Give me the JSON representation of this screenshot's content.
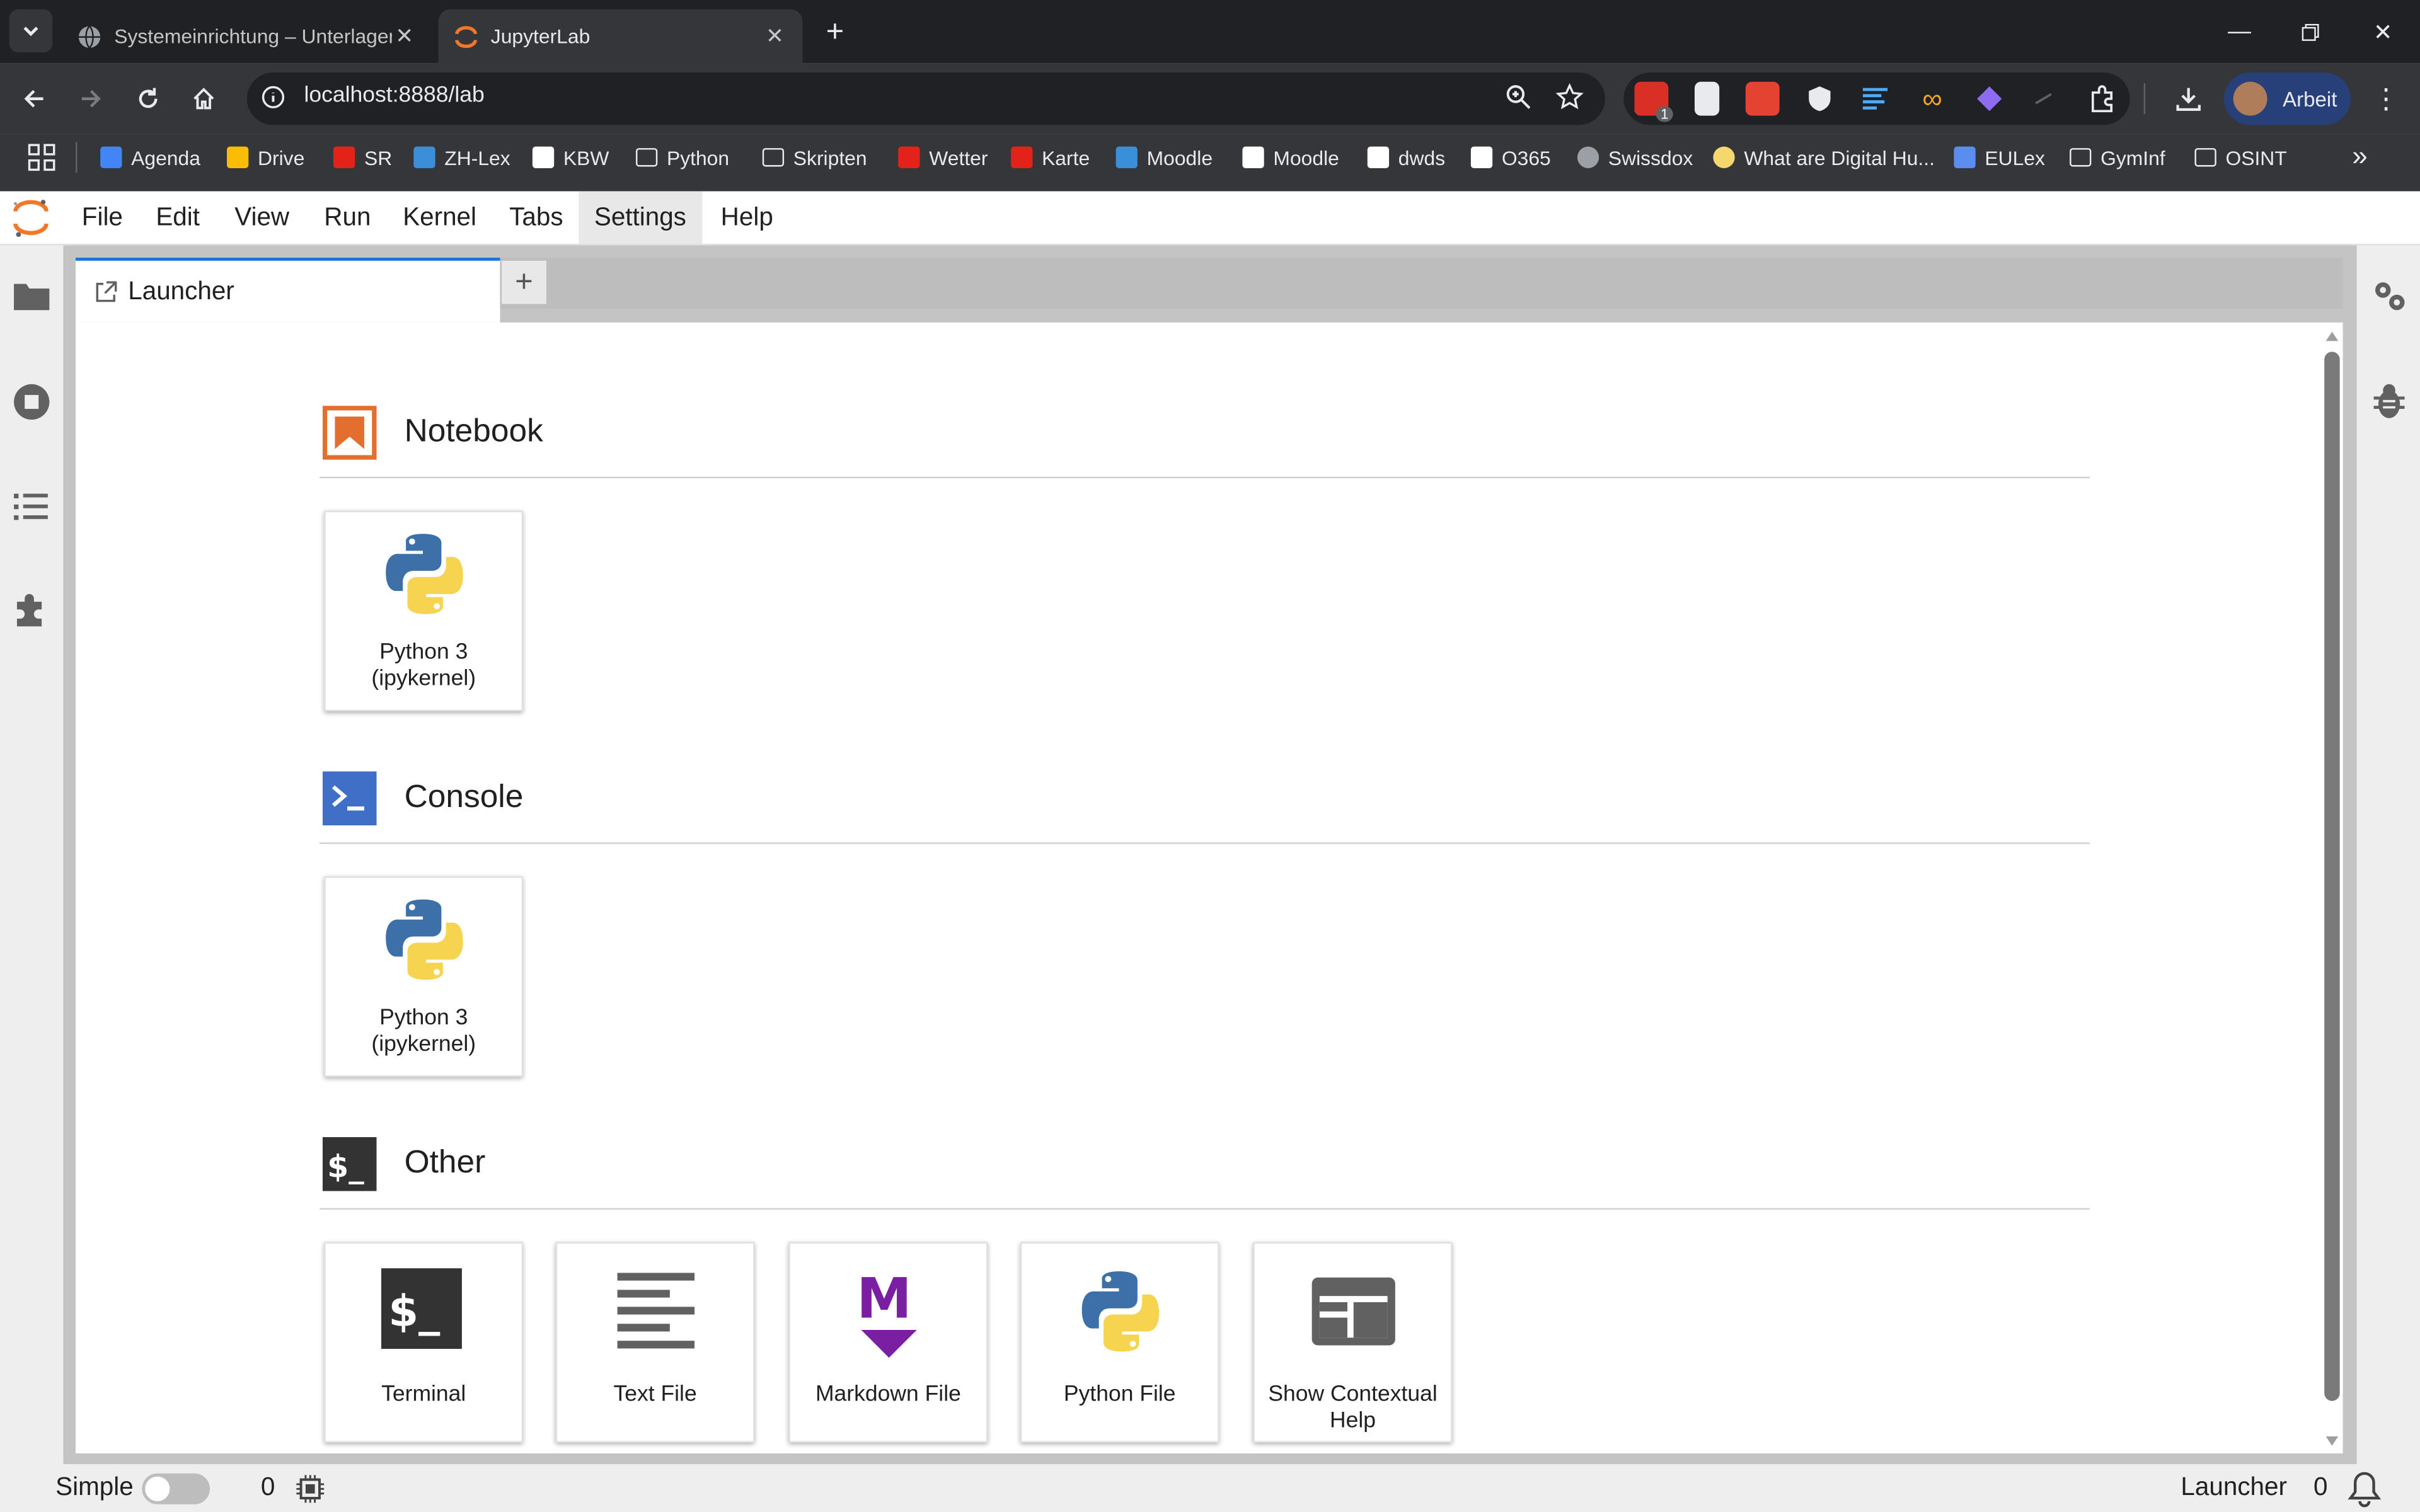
{
  "browser": {
    "tabs": [
      {
        "title": "Systemeinrichtung – Unterlagen",
        "icon": "globe-icon"
      },
      {
        "title": "JupyterLab",
        "icon": "jupyter-icon"
      }
    ],
    "url": "localhost:8888/lab",
    "profile_label": "Arbeit",
    "bookmarks": [
      {
        "label": "Agenda",
        "icon": "calendar-icon",
        "color": "#4285f4"
      },
      {
        "label": "Drive",
        "icon": "drive-icon",
        "color": "#fbbc04"
      },
      {
        "label": "SR",
        "icon": "swiss-flag-icon",
        "color": "#e32219"
      },
      {
        "label": "ZH-Lex",
        "icon": "zhlex-icon",
        "color": "#3b8fd9"
      },
      {
        "label": "KBW",
        "icon": "github-icon",
        "color": "#ffffff"
      },
      {
        "label": "Python",
        "icon": "folder-icon",
        "color": "#e8eaed"
      },
      {
        "label": "Skripten",
        "icon": "folder-icon",
        "color": "#e8eaed"
      },
      {
        "label": "Wetter",
        "icon": "swiss-flag-icon",
        "color": "#e32219"
      },
      {
        "label": "Karte",
        "icon": "swiss-flag-icon",
        "color": "#e32219"
      },
      {
        "label": "Moodle",
        "icon": "moodle-icon",
        "color": "#3b8fd9"
      },
      {
        "label": "Moodle",
        "icon": "moodle-f-icon",
        "color": "#ffffff"
      },
      {
        "label": "dwds",
        "icon": "dwds-icon",
        "color": "#ffffff"
      },
      {
        "label": "O365",
        "icon": "o365-icon",
        "color": "#ffffff"
      },
      {
        "label": "Swissdox",
        "icon": "globe-icon",
        "color": "#9aa0a6"
      },
      {
        "label": "What are Digital Hu...",
        "icon": "sun-icon",
        "color": "#f5d76e"
      },
      {
        "label": "EULex",
        "icon": "eulex-icon",
        "color": "#5b8def"
      },
      {
        "label": "GymInf",
        "icon": "folder-icon",
        "color": "#e8eaed"
      },
      {
        "label": "OSINT",
        "icon": "folder-icon",
        "color": "#e8eaed"
      }
    ],
    "extension_badge": "1"
  },
  "jupyter": {
    "menu": [
      "File",
      "Edit",
      "View",
      "Run",
      "Kernel",
      "Tabs",
      "Settings",
      "Help"
    ],
    "active_menu": "Settings",
    "tab_title": "Launcher",
    "sections": {
      "notebook": {
        "title": "Notebook",
        "cards": [
          {
            "line1": "Python 3",
            "line2": "(ipykernel)"
          }
        ]
      },
      "console": {
        "title": "Console",
        "cards": [
          {
            "line1": "Python 3",
            "line2": "(ipykernel)"
          }
        ]
      },
      "other": {
        "title": "Other",
        "cards": [
          {
            "line1": "Terminal",
            "line2": ""
          },
          {
            "line1": "Text File",
            "line2": ""
          },
          {
            "line1": "Markdown File",
            "line2": ""
          },
          {
            "line1": "Python File",
            "line2": ""
          },
          {
            "line1": "Show Contextual",
            "line2": "Help"
          }
        ]
      }
    },
    "status": {
      "mode_label": "Simple",
      "kernel_count": "0",
      "right_label": "Launcher",
      "right_count": "0"
    }
  },
  "colors": {
    "accent": "#1976d2",
    "notebook_orange": "#e46e2e",
    "console_blue": "#3f6fc7",
    "markdown_purple": "#7b1fa2"
  }
}
